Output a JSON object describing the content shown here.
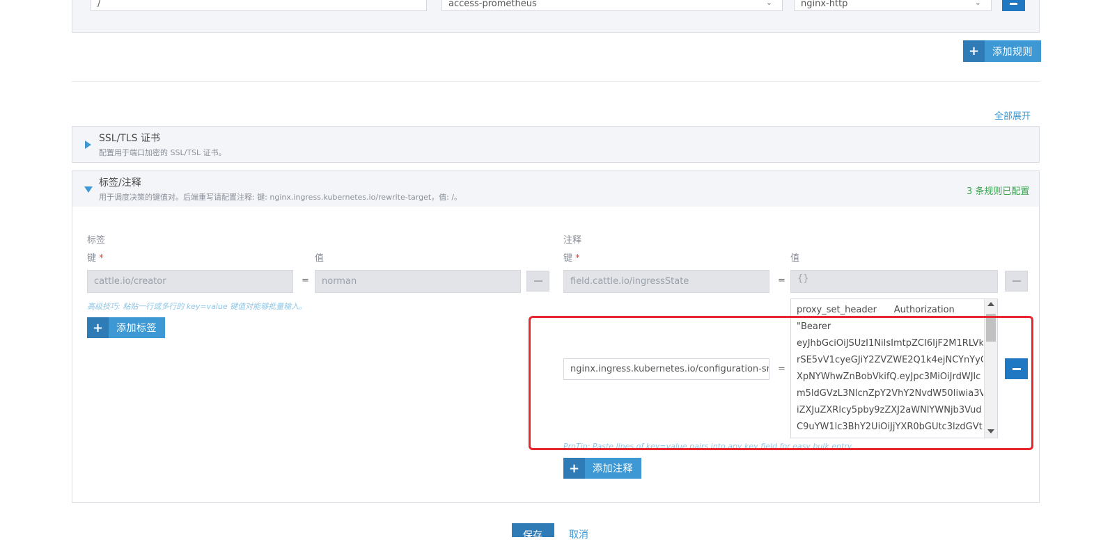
{
  "rule_row": {
    "path_value": "/",
    "target_value": "access-prometheus",
    "port_value": "nginx-http"
  },
  "add_rule_label": "添加规则",
  "expand_all_label": "全部展开",
  "ssl_section": {
    "title": "SSL/TLS 证书",
    "subtitle": "配置用于端口加密的 SSL/TSL 证书。"
  },
  "labels_section": {
    "title": "标签/注释",
    "subtitle": "用于调度决策的键值对。后端重写请配置注释: 键: nginx.ingress.kubernetes.io/rewrite-target，值: /。",
    "status": "3 条规则已配置"
  },
  "labels": {
    "heading": "标签",
    "key_label": "键",
    "required_mark": "*",
    "value_label": "值",
    "rows": [
      {
        "key": "cattle.io/creator",
        "value": "norman"
      }
    ],
    "protip": "高级技巧: 粘贴一行或多行的 key=value 键值对能够批量输入。",
    "add_label": "添加标签"
  },
  "annotations": {
    "heading": "注释",
    "key_label": "键",
    "required_mark": "*",
    "value_label": "值",
    "row1": {
      "key": "field.cattle.io/ingressState",
      "value": "{}"
    },
    "row2": {
      "key": "nginx.ingress.kubernetes.io/configuration-sn",
      "value_lines": [
        "proxy_set_header      Authorization",
        "\"Bearer",
        "eyJhbGciOiJSUzI1NiIsImtpZCI6IjF2M1RLVkx",
        "rSE5vV1cyeGJiY2ZVZWE2Q1k4ejNCYnYyQ",
        "XpNYWhwZnBobVkifQ.eyJpc3MiOiJrdWJlc",
        "m5ldGVzL3NlcnZpY2VhY2NvdW50Iiwia3V",
        "iZXJuZXRlcy5pby9zZXJ2aWNlYWNjb3Vud",
        "C9uYW1lc3BhY2UiOiJjYXR0bGUtc3lzdGVtI"
      ]
    },
    "protip": "ProTip: Paste lines of key=value pairs into any key field for easy bulk entry.",
    "add_label": "添加注释"
  },
  "footer": {
    "save_label": "保存",
    "cancel_label": "取消"
  },
  "colors": {
    "primary": "#3d98d3",
    "primary_dark": "#1f78c1",
    "success": "#3aa550",
    "highlight": "#e8262d"
  }
}
